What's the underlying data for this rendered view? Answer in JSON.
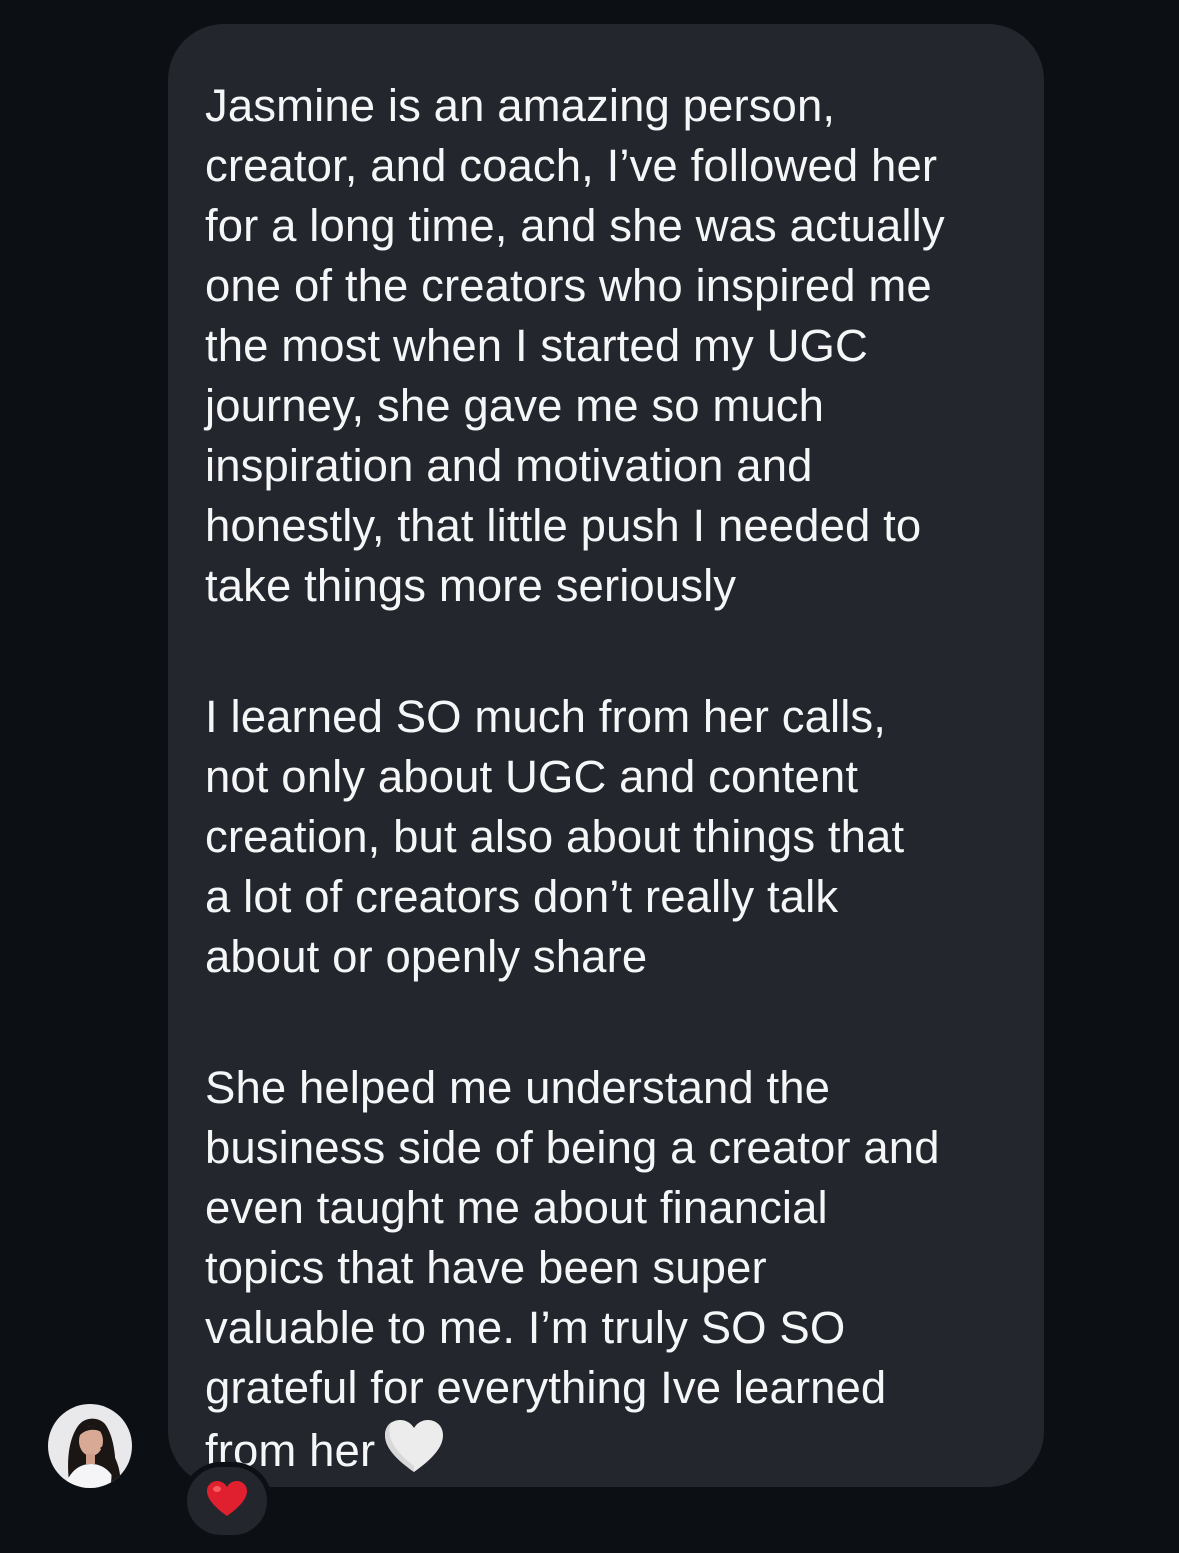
{
  "message": {
    "paragraphs": [
      "Jasmine is an amazing person,\ncreator, and coach, I’ve followed her\nfor a long time, and she was actually\none of the creators who inspired me\nthe most when I started my UGC\njourney, she gave me so much\ninspiration and motivation and\nhonestly, that little push I needed to\ntake things more seriously",
      "I learned SO much from her calls,\nnot only about UGC and content\ncreation, but also about things that\na lot of creators don’t really talk\nabout or openly share",
      "She helped me understand the\nbusiness side of being a creator and\neven taught me about financial\ntopics that have been super\nvaluable to me. I’m truly SO SO\ngrateful for everything Ive learned\nfrom her"
    ],
    "trailing_emoji": "white-heart-icon"
  },
  "reaction": {
    "emoji": "red-heart-icon",
    "color": "#e0202f"
  },
  "colors": {
    "background": "#0c1014",
    "bubble": "#23272d",
    "text": "#f5f6f7"
  }
}
